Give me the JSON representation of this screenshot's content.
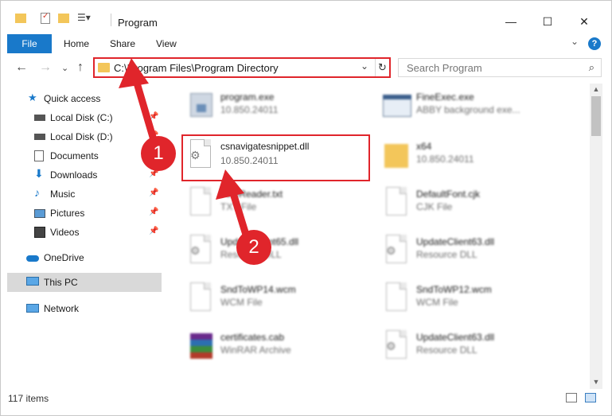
{
  "window": {
    "title": "Program",
    "controls": {
      "minimize": "—",
      "maximize": "☐",
      "close": "✕"
    }
  },
  "ribbon": {
    "file": "File",
    "tabs": [
      "Home",
      "Share",
      "View"
    ]
  },
  "address": {
    "path": "C:\\Program Files\\Program Directory",
    "search_placeholder": "Search Program"
  },
  "sidebar": {
    "items": [
      {
        "label": "Quick access",
        "icon": "star-icon",
        "pinned": false
      },
      {
        "label": "Local Disk (C:)",
        "icon": "drive-icon",
        "pinned": true
      },
      {
        "label": "Local Disk (D:)",
        "icon": "drive-icon",
        "pinned": true
      },
      {
        "label": "Documents",
        "icon": "documents-icon",
        "pinned": true
      },
      {
        "label": "Downloads",
        "icon": "download-icon",
        "pinned": true
      },
      {
        "label": "Music",
        "icon": "music-icon",
        "pinned": true
      },
      {
        "label": "Pictures",
        "icon": "pictures-icon",
        "pinned": true
      },
      {
        "label": "Videos",
        "icon": "videos-icon",
        "pinned": true
      },
      {
        "label": "OneDrive",
        "icon": "cloud-icon",
        "pinned": false
      },
      {
        "label": "This PC",
        "icon": "computer-icon",
        "pinned": false
      },
      {
        "label": "Network",
        "icon": "network-icon",
        "pinned": false
      }
    ]
  },
  "files": [
    {
      "name": "program.exe",
      "sub": "10.850.24011",
      "kind": "exe"
    },
    {
      "name": "FineExec.exe",
      "sub": "ABBY background exe...",
      "kind": "window"
    },
    {
      "name": "csnavigatesnippet.dll",
      "sub": "10.850.24011",
      "kind": "dll"
    },
    {
      "name": "x64",
      "sub": "10.850.24011",
      "kind": "folder"
    },
    {
      "name": "FineReader.txt",
      "sub": "TXT File",
      "kind": "txt"
    },
    {
      "name": "DefaultFont.cjk",
      "sub": "CJK File",
      "kind": "txt"
    },
    {
      "name": "UpdateClient65.dll",
      "sub": "Resource DLL",
      "kind": "dll"
    },
    {
      "name": "UpdateClient63.dll",
      "sub": "Resource DLL",
      "kind": "dll"
    },
    {
      "name": "SndToWP14.wcm",
      "sub": "WCM File",
      "kind": "txt"
    },
    {
      "name": "SndToWP12.wcm",
      "sub": "WCM File",
      "kind": "txt"
    },
    {
      "name": "certificates.cab",
      "sub": "WinRAR Archive",
      "kind": "archive"
    },
    {
      "name": "UpdateClient63.dll",
      "sub": "Resource DLL",
      "kind": "dll"
    }
  ],
  "status": {
    "items": "117 items"
  },
  "callouts": {
    "one": "1",
    "two": "2"
  },
  "colors": {
    "accent": "#1979ca",
    "highlight": "#e0252b",
    "folder": "#f3c65a"
  }
}
